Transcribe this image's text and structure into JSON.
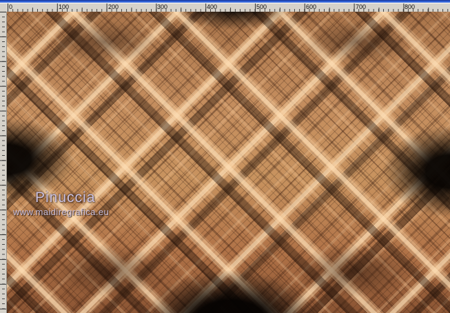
{
  "window": {
    "top_strip_color": "#2e5ed2"
  },
  "rulers": {
    "unit": "px",
    "horizontal_labels": [
      "0",
      "100",
      "200",
      "300",
      "400",
      "500",
      "600",
      "700",
      "800"
    ],
    "background_color": "#d6d2ca",
    "tick_color": "#3c3c3c"
  },
  "canvas": {
    "watermark": {
      "name": "Pinuccia",
      "url": "www.maidiregrafica.eu",
      "text_color": "#cac1e0"
    },
    "pattern_palette": {
      "base_tan": "#c28a5a",
      "highlight": "#f4d2a2",
      "mid_brown": "#8a5a38",
      "dark_brown": "#46291a",
      "near_black": "#0d0704"
    }
  }
}
